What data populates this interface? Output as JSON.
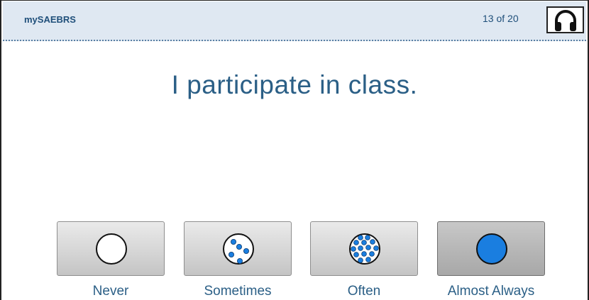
{
  "header": {
    "app_title": "mySAEBRS",
    "progress": "13 of 20",
    "audio_icon": "headphones-icon"
  },
  "question": {
    "text": "I participate in class."
  },
  "options": [
    {
      "label": "Never",
      "icon": "empty-circle-icon",
      "selected": false
    },
    {
      "label": "Sometimes",
      "icon": "few-dots-circle-icon",
      "selected": false
    },
    {
      "label": "Often",
      "icon": "many-dots-circle-icon",
      "selected": false
    },
    {
      "label": "Almost Always",
      "icon": "filled-circle-icon",
      "selected": true
    }
  ],
  "colors": {
    "header_bg": "#dfe8f2",
    "text_blue": "#2b5f86",
    "dot_blue": "#1a7ee0"
  }
}
